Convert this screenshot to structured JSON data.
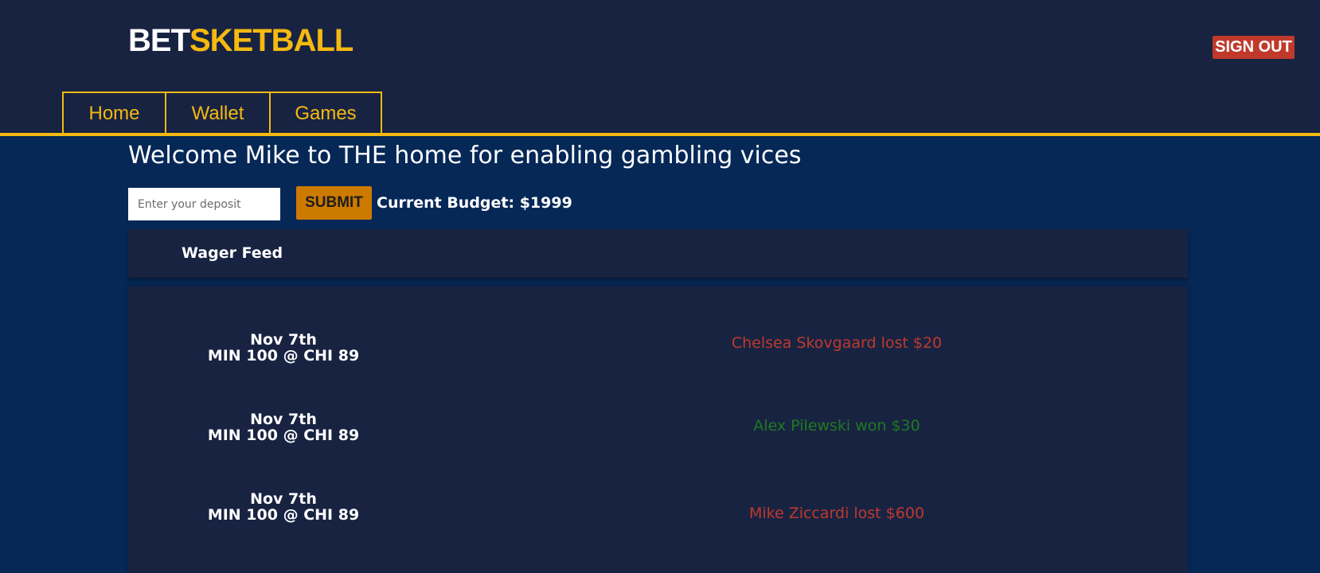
{
  "header": {
    "logo": {
      "part1": "BET",
      "part2": "SKETBALL"
    },
    "signout_label": "SIGN OUT"
  },
  "nav": {
    "tabs": [
      {
        "label": "Home"
      },
      {
        "label": "Wallet"
      },
      {
        "label": "Games"
      }
    ]
  },
  "main": {
    "welcome": "Welcome Mike to THE home for enabling gambling vices",
    "deposit": {
      "placeholder": "Enter your deposit",
      "value": "",
      "submit_label": "SUBMIT"
    },
    "budget": "Current Budget: $1999"
  },
  "feed": {
    "title": "Wager Feed",
    "items": [
      {
        "date": "Nov 7th",
        "game": "MIN 100 @ CHI 89",
        "result": "Chelsea Skovgaard lost $20",
        "outcome": "lost"
      },
      {
        "date": "Nov 7th",
        "game": "MIN 100 @ CHI 89",
        "result": "Alex Pilewski won $30",
        "outcome": "won"
      },
      {
        "date": "Nov 7th",
        "game": "MIN 100 @ CHI 89",
        "result": "Mike Ziccardi lost $600",
        "outcome": "lost"
      }
    ]
  },
  "colors": {
    "header_bg": "#182342",
    "page_bg": "#062857",
    "accent_yellow": "#f5b90f",
    "signout_red": "#c0392b",
    "submit_orange": "#cc7a00",
    "lost_red": "#c0392b",
    "won_green": "#1e7a1e"
  }
}
